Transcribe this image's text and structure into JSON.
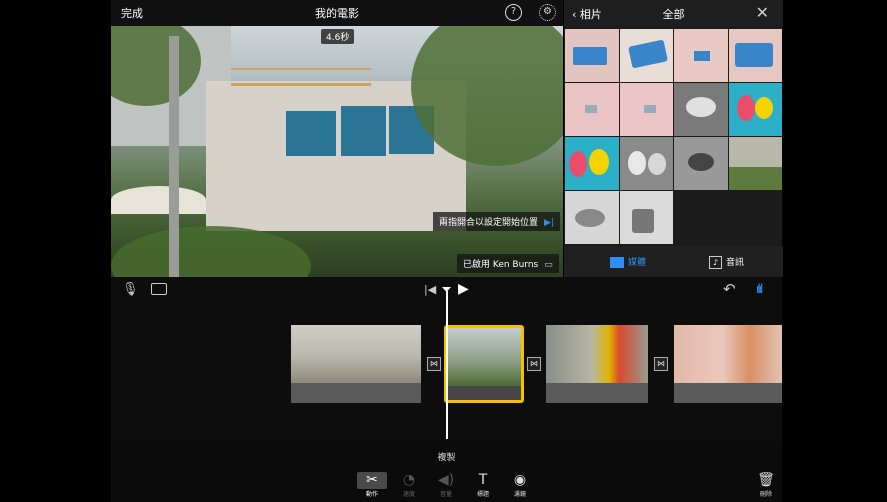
{
  "header": {
    "done_label": "完成",
    "title": "我的電影",
    "help_icon": "help-icon",
    "settings_icon": "gear-icon"
  },
  "preview": {
    "duration": "4.6秒",
    "hint_pinch": "兩指開合以設定開始位置",
    "hint_kenburns": "已啟用 Ken Burns"
  },
  "photos_panel": {
    "back_label": "相片",
    "title": "全部",
    "tabs": [
      {
        "label": "媒體",
        "active": true
      },
      {
        "label": "音訊",
        "active": false
      }
    ]
  },
  "timeline_tools": {
    "mic_icon": "microphone-icon",
    "camera_icon": "camera-icon",
    "undo_icon": "undo-icon",
    "audio_wave_icon": "waveform-icon"
  },
  "bottom": {
    "duplicate_label": "複製",
    "tools": [
      {
        "label": "動作",
        "icon": "scissors-icon",
        "state": "on"
      },
      {
        "label": "速度",
        "icon": "speed-icon",
        "state": "off"
      },
      {
        "label": "音量",
        "icon": "volume-icon",
        "state": "off"
      },
      {
        "label": "標題",
        "icon": "title-icon",
        "state": "lit"
      },
      {
        "label": "濾鏡",
        "icon": "filter-icon",
        "state": "lit"
      }
    ],
    "delete_label": "刪除"
  },
  "colors": {
    "accent": "#2f8ff5",
    "selection": "#f6c000",
    "background": "#0d0d0d"
  }
}
